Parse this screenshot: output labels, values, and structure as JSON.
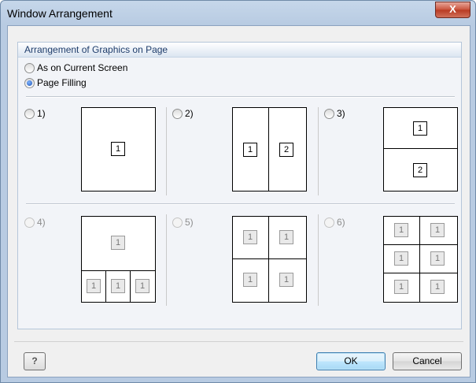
{
  "window": {
    "title": "Window Arrangement",
    "close_label": "X"
  },
  "group": {
    "title": "Arrangement of Graphics on Page"
  },
  "mode_options": [
    {
      "label": "As on Current Screen",
      "checked": false
    },
    {
      "label": "Page Filling",
      "checked": true
    }
  ],
  "layouts": [
    {
      "label": "1)",
      "checked": false,
      "enabled": true
    },
    {
      "label": "2)",
      "checked": false,
      "enabled": true
    },
    {
      "label": "3)",
      "checked": false,
      "enabled": true
    },
    {
      "label": "4)",
      "checked": false,
      "enabled": false
    },
    {
      "label": "5)",
      "checked": false,
      "enabled": false
    },
    {
      "label": "6)",
      "checked": false,
      "enabled": false
    }
  ],
  "cell_number": "1",
  "cell_number_2": "2",
  "buttons": {
    "ok": "OK",
    "cancel": "Cancel",
    "help_icon": "help-icon"
  },
  "colors": {
    "title_gradient": "#c6d7ea",
    "close": "#c9523b",
    "default_button": "#bee6fd"
  }
}
